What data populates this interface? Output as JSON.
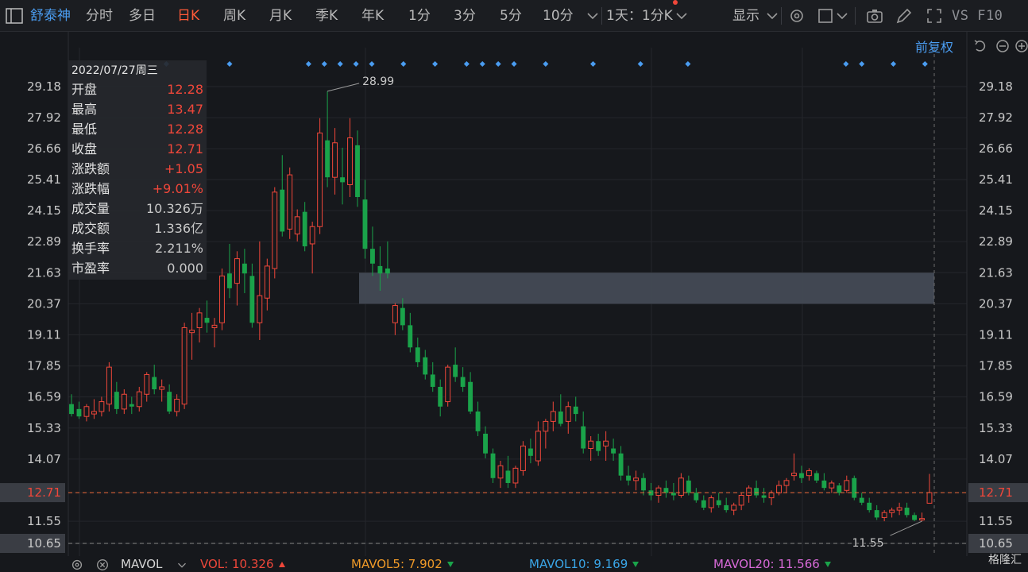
{
  "toolbar": {
    "stock_name": "舒泰神",
    "tabs": [
      "分时",
      "多日",
      "日K",
      "周K",
      "月K",
      "季K",
      "年K",
      "1分",
      "3分",
      "5分",
      "10分"
    ],
    "active_tab": "日K",
    "period_select": "1天：1分K",
    "display_label": "显示",
    "vs_f10": "VS F10"
  },
  "subbar": {
    "adjust_label": "前复权"
  },
  "info_panel": {
    "date": "2022/07/27周三",
    "rows": [
      {
        "label": "开盘",
        "value": "12.28",
        "color": "red"
      },
      {
        "label": "最高",
        "value": "13.47",
        "color": "red"
      },
      {
        "label": "最低",
        "value": "12.28",
        "color": "red"
      },
      {
        "label": "收盘",
        "value": "12.71",
        "color": "red"
      },
      {
        "label": "涨跌额",
        "value": "+1.05",
        "color": "red"
      },
      {
        "label": "涨跌幅",
        "value": "+9.01%",
        "color": "red"
      },
      {
        "label": "成交量",
        "value": "10.326万",
        "color": "gray"
      },
      {
        "label": "成交额",
        "value": "1.336亿",
        "color": "gray"
      },
      {
        "label": "换手率",
        "value": "2.211%",
        "color": "gray"
      },
      {
        "label": "市盈率",
        "value": "0.000",
        "color": "gray"
      }
    ]
  },
  "bottom": {
    "indicator": "MAVOL",
    "vol_label": "VOL:",
    "vol_value": "10.326",
    "mavol5_label": "MAVOL5:",
    "mavol5_value": "7.902",
    "mavol10_label": "MAVOL10:",
    "mavol10_value": "9.169",
    "mavol20_label": "MAVOL20:",
    "mavol20_value": "11.566"
  },
  "watermark": "格隆汇",
  "colors": {
    "up": "#f0473a",
    "down": "#1aa34a",
    "accent": "#4a9cf0",
    "active": "#ff5a38"
  },
  "chart_data": {
    "type": "candlestick",
    "y_ticks": [
      "29.18",
      "27.92",
      "26.66",
      "25.41",
      "24.15",
      "22.89",
      "21.63",
      "20.37",
      "19.11",
      "17.85",
      "16.59",
      "15.33",
      "14.07",
      "12.71",
      "11.55",
      "10.65"
    ],
    "ylim": [
      10.65,
      29.18
    ],
    "current_price": "12.71",
    "max_label": "28.99",
    "min_label": "11.55",
    "candles": [
      [
        16.3,
        16.7,
        15.8,
        15.9
      ],
      [
        16.1,
        16.4,
        15.7,
        15.8
      ],
      [
        15.8,
        16.3,
        15.6,
        16.2
      ],
      [
        15.9,
        16.5,
        15.7,
        16.0
      ],
      [
        16.0,
        16.6,
        15.8,
        16.4
      ],
      [
        16.3,
        18.0,
        16.0,
        17.8
      ],
      [
        16.8,
        17.2,
        15.9,
        16.1
      ],
      [
        16.1,
        16.9,
        15.9,
        16.7
      ],
      [
        16.3,
        16.6,
        15.9,
        16.2
      ],
      [
        16.2,
        17.0,
        16.0,
        16.8
      ],
      [
        16.7,
        17.6,
        16.4,
        17.5
      ],
      [
        17.4,
        17.9,
        16.7,
        16.9
      ],
      [
        16.9,
        17.3,
        16.4,
        17.0
      ],
      [
        16.8,
        17.1,
        15.9,
        16.0
      ],
      [
        16.0,
        16.7,
        15.8,
        16.5
      ],
      [
        16.3,
        19.6,
        16.1,
        19.4
      ],
      [
        19.2,
        20.0,
        18.1,
        19.3
      ],
      [
        19.4,
        20.2,
        18.8,
        20.0
      ],
      [
        19.8,
        20.5,
        19.2,
        19.6
      ],
      [
        19.4,
        19.8,
        18.6,
        19.5
      ],
      [
        19.6,
        21.8,
        19.3,
        21.5
      ],
      [
        21.6,
        22.8,
        20.6,
        21.0
      ],
      [
        21.2,
        22.5,
        20.3,
        22.2
      ],
      [
        22.0,
        22.6,
        20.8,
        21.6
      ],
      [
        21.5,
        22.0,
        19.4,
        19.6
      ],
      [
        19.6,
        22.9,
        18.9,
        20.7
      ],
      [
        20.6,
        22.2,
        20.1,
        21.9
      ],
      [
        21.8,
        25.1,
        21.4,
        24.9
      ],
      [
        25.0,
        26.4,
        23.1,
        23.3
      ],
      [
        23.4,
        25.9,
        23.0,
        25.6
      ],
      [
        23.2,
        24.2,
        22.9,
        23.9
      ],
      [
        24.1,
        24.5,
        22.5,
        22.7
      ],
      [
        22.8,
        23.7,
        21.6,
        23.5
      ],
      [
        23.5,
        27.9,
        23.2,
        27.3
      ],
      [
        27.0,
        28.99,
        25.1,
        25.5
      ],
      [
        25.5,
        27.5,
        24.8,
        26.9
      ],
      [
        25.5,
        26.7,
        24.4,
        25.3
      ],
      [
        25.2,
        27.9,
        24.7,
        27.1
      ],
      [
        26.8,
        27.4,
        24.3,
        24.7
      ],
      [
        24.6,
        25.4,
        22.2,
        22.6
      ],
      [
        22.6,
        23.5,
        21.5,
        22.0
      ],
      [
        21.9,
        22.7,
        20.9,
        21.6
      ],
      [
        21.8,
        22.9,
        21.4,
        21.6
      ],
      [
        19.6,
        20.4,
        19.1,
        20.3
      ],
      [
        20.2,
        20.6,
        19.3,
        19.5
      ],
      [
        19.5,
        20.0,
        18.4,
        18.6
      ],
      [
        18.6,
        19.0,
        17.8,
        18.0
      ],
      [
        18.2,
        18.5,
        17.3,
        17.5
      ],
      [
        17.5,
        18.0,
        16.8,
        17.0
      ],
      [
        17.0,
        17.3,
        15.8,
        16.2
      ],
      [
        16.4,
        17.9,
        16.2,
        17.8
      ],
      [
        17.9,
        18.6,
        17.2,
        17.4
      ],
      [
        17.4,
        17.8,
        16.8,
        17.0
      ],
      [
        17.2,
        17.6,
        15.9,
        16.0
      ],
      [
        16.0,
        16.4,
        15.0,
        15.2
      ],
      [
        15.1,
        15.4,
        14.1,
        14.3
      ],
      [
        14.3,
        14.5,
        13.1,
        13.3
      ],
      [
        13.3,
        14.0,
        12.9,
        13.8
      ],
      [
        13.6,
        14.2,
        12.9,
        13.1
      ],
      [
        13.1,
        13.8,
        12.9,
        13.7
      ],
      [
        13.6,
        14.8,
        13.4,
        14.6
      ],
      [
        14.5,
        14.9,
        13.9,
        14.2
      ],
      [
        14.0,
        15.6,
        13.8,
        15.2
      ],
      [
        15.2,
        15.7,
        14.5,
        15.6
      ],
      [
        15.6,
        16.4,
        15.2,
        16.0
      ],
      [
        16.0,
        16.7,
        15.4,
        15.5
      ],
      [
        15.6,
        16.4,
        15.1,
        16.2
      ],
      [
        16.2,
        16.6,
        15.6,
        15.9
      ],
      [
        15.4,
        16.0,
        14.3,
        14.5
      ],
      [
        14.5,
        15.0,
        14.0,
        14.8
      ],
      [
        14.8,
        15.1,
        14.2,
        14.4
      ],
      [
        14.6,
        15.2,
        14.0,
        14.8
      ],
      [
        14.5,
        14.9,
        14.0,
        14.3
      ],
      [
        14.3,
        14.6,
        13.2,
        13.4
      ],
      [
        13.4,
        13.8,
        13.0,
        13.2
      ],
      [
        13.2,
        13.6,
        12.8,
        13.3
      ],
      [
        13.3,
        13.5,
        12.6,
        12.8
      ],
      [
        12.8,
        13.1,
        12.4,
        12.6
      ],
      [
        12.6,
        13.0,
        12.3,
        12.9
      ],
      [
        12.9,
        13.2,
        12.5,
        12.7
      ],
      [
        12.7,
        13.1,
        12.4,
        12.6
      ],
      [
        12.6,
        13.5,
        12.5,
        13.3
      ],
      [
        13.2,
        13.4,
        12.6,
        12.7
      ],
      [
        12.7,
        12.9,
        12.3,
        12.4
      ],
      [
        12.4,
        12.6,
        12.0,
        12.1
      ],
      [
        12.1,
        12.6,
        11.9,
        12.5
      ],
      [
        12.4,
        12.7,
        12.1,
        12.2
      ],
      [
        12.2,
        12.5,
        11.9,
        12.0
      ],
      [
        12.0,
        12.3,
        11.8,
        12.2
      ],
      [
        12.2,
        12.7,
        12.0,
        12.6
      ],
      [
        12.6,
        13.0,
        12.3,
        12.9
      ],
      [
        12.9,
        13.2,
        12.5,
        12.6
      ],
      [
        12.6,
        12.9,
        12.3,
        12.5
      ],
      [
        12.5,
        12.8,
        12.2,
        12.7
      ],
      [
        12.7,
        13.2,
        12.6,
        13.0
      ],
      [
        13.0,
        13.3,
        12.7,
        13.2
      ],
      [
        13.4,
        14.3,
        13.2,
        13.5
      ],
      [
        13.5,
        13.8,
        13.1,
        13.3
      ],
      [
        13.4,
        13.7,
        13.2,
        13.6
      ],
      [
        13.5,
        13.6,
        13.1,
        13.2
      ],
      [
        13.2,
        13.5,
        12.8,
        12.9
      ],
      [
        12.9,
        13.2,
        12.7,
        13.1
      ],
      [
        13.0,
        13.1,
        12.6,
        12.7
      ],
      [
        12.8,
        13.4,
        12.7,
        13.2
      ],
      [
        13.3,
        13.4,
        12.4,
        12.5
      ],
      [
        12.5,
        12.7,
        12.2,
        12.3
      ],
      [
        12.3,
        12.5,
        11.9,
        12.0
      ],
      [
        12.0,
        12.2,
        11.6,
        11.7
      ],
      [
        11.7,
        12.0,
        11.55,
        11.9
      ],
      [
        11.9,
        12.1,
        11.7,
        12.0
      ],
      [
        12.0,
        12.3,
        11.8,
        12.1
      ],
      [
        12.1,
        12.3,
        11.7,
        11.8
      ],
      [
        11.8,
        11.9,
        11.55,
        11.6
      ],
      [
        11.6,
        11.9,
        11.55,
        11.66
      ],
      [
        12.28,
        13.47,
        12.28,
        12.71
      ]
    ],
    "dot_markers_at": [
      6,
      10,
      15,
      16,
      17,
      18,
      19,
      21,
      23,
      25,
      26,
      27,
      28,
      30,
      33,
      36,
      39,
      49,
      50,
      52,
      54
    ],
    "box_range": [
      20.37,
      21.63
    ]
  }
}
